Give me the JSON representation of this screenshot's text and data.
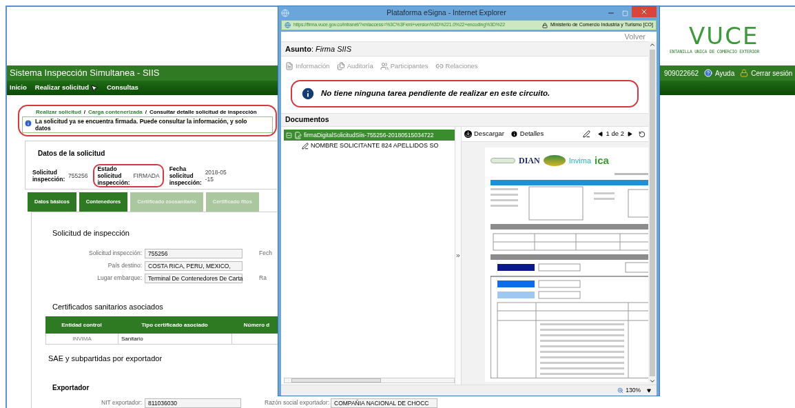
{
  "page": {
    "logo": {
      "name": "VUCE",
      "subtitle": "ENTANILLA UNICA DE COMERCIO EXTERIOR"
    },
    "app_title": "Sistema Inspección Simultanea - SIIS",
    "user_bar": {
      "user": "909022662",
      "help": "Ayuda",
      "logout": "Cerrar sesión"
    },
    "nav": [
      "Inicio",
      "Realizar solicitud",
      "Consultas"
    ],
    "breadcrumb": {
      "links": [
        "Realizar solicitud",
        "Carga contenerizada"
      ],
      "separator": "/",
      "current": "Consultar detalle solicitud de inspección"
    },
    "notice": "La solicitud ya se encuentra firmada. Puede consultar la información, y solo\ndatos",
    "summary": {
      "title": "Datos de la solicitud",
      "fields": [
        {
          "label": "Solicitud inspección:",
          "value": "755256",
          "highlighted": false
        },
        {
          "label": "Estado solicitud inspección:",
          "value": "FIRMADA",
          "highlighted": true
        },
        {
          "label": "Fecha solicitud inspección:",
          "value": "2018-05\n-15",
          "highlighted": false
        }
      ]
    },
    "tabs": [
      {
        "label": "Datos básicos",
        "disabled": false
      },
      {
        "label": "Contenedores",
        "disabled": false
      },
      {
        "label": "Certificado zoosanitario",
        "disabled": true
      },
      {
        "label": "Certificado fitos",
        "disabled": true
      }
    ],
    "section_title": "Solicitud de inspección",
    "form": [
      {
        "label": "Solicitud inspección:",
        "value": "755256",
        "side_label": "Fech"
      },
      {
        "label": "País destino:",
        "value": "COSTA RICA, PERU, MEXICO,"
      },
      {
        "label": "Lugar embarque:",
        "value": "Terminal De Contenedores De Carta",
        "side_label": "Ra"
      }
    ],
    "certificates": {
      "title": "Certificados sanitarios asociados",
      "columns": [
        "Entidad control",
        "Tipo certificado asociado",
        "Número d"
      ],
      "rows": [
        {
          "column_1": "INVIMA",
          "column_2": "Sanitario"
        }
      ]
    },
    "sae_title": "SAE y subpartidas por exportador",
    "exporter": {
      "title": "Exportador",
      "fields": [
        {
          "label": "NIT exportador:",
          "value": "811036030"
        },
        {
          "label": "Razón social exportador:",
          "value": "COMPAÑIA NACIONAL DE CHOCC"
        }
      ]
    }
  },
  "popup": {
    "title": "Plataforma eSigna - Internet Explorer",
    "url": "https://firma.vuce.gov.co/intranet/?xmlaccess=%3C%3Fxml+version%3D%221.0%22+encoding%3D%22",
    "site": "Ministerio de Comercio Industria y Turismo [CO]",
    "back": "Volver",
    "subject": "**Asunto**: *Firma SIIS*",
    "actions": [
      "Información",
      "Auditoría",
      "Participantes",
      "Relaciones"
    ],
    "message": "No tiene ninguna tarea pendiente de realizar en este circuito.",
    "documents_title": "Documentos",
    "tree": [
      {
        "label": "firmaDigitalSolicitudSiis-755256-20180515034722",
        "selected": true,
        "expanded": true,
        "children": [
          {
            "label": "NOMBRE SOLICITANTE 824 APELLIDOS SO",
            "selected": false
          }
        ]
      }
    ],
    "viewer": {
      "download": "Descargar",
      "details": "Detalles",
      "page": "1 de 2",
      "zoom": "130%",
      "document": {
        "logos": [
          "DIAN",
          "Invima",
          "ica"
        ]
      }
    }
  }
}
